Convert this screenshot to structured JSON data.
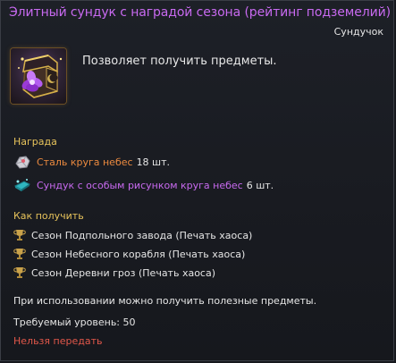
{
  "item": {
    "name": "Элитный сундук с наградой сезона (рейтинг подземелий)",
    "type": "Сундучок",
    "description": "Позволяет получить предметы.",
    "icon": "purple-treasure-chest-icon"
  },
  "reward": {
    "label": "Награда",
    "items": [
      {
        "name": "Сталь круга небес",
        "qty": "18 шт.",
        "color": "#ec8a3f",
        "icon": "steel-ore-icon"
      },
      {
        "name": "Сундук с особым рисунком круга небес",
        "qty": "6 шт.",
        "color": "#c86af0",
        "icon": "teal-chest-icon"
      }
    ]
  },
  "obtain": {
    "label": "Как получить",
    "items": [
      "Сезон Подпольного завода (Печать хаоса)",
      "Сезон Небесного корабля (Печать хаоса)",
      "Сезон Деревни гроз (Печать хаоса)"
    ],
    "icon": "trophy-icon"
  },
  "usage_note": "При использовании можно получить полезные предметы.",
  "required_level": "Требуемый уровень: 50",
  "trade_restriction": "Нельзя передать",
  "colors": {
    "title": "#c86af0",
    "section": "#e7c35b",
    "restriction": "#e2574a"
  }
}
